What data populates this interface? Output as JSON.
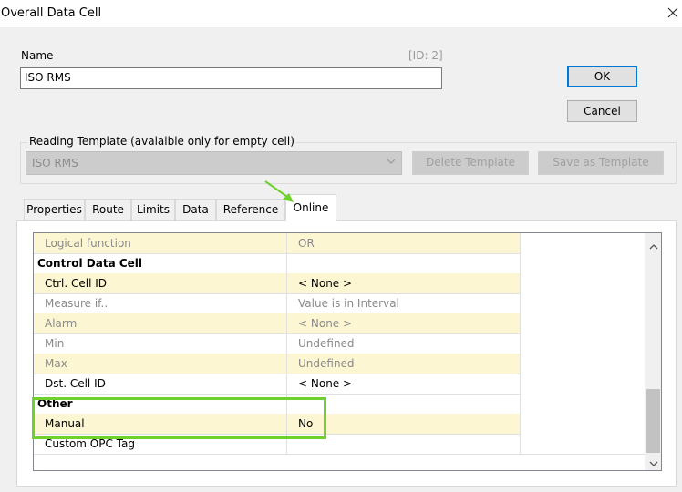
{
  "window": {
    "title": "Overall Data Cell"
  },
  "name_section": {
    "label": "Name",
    "id_label": "[ID: 2]",
    "value": "ISO RMS"
  },
  "buttons": {
    "ok": "OK",
    "cancel": "Cancel",
    "delete_template": "Delete Template",
    "save_template": "Save as Template"
  },
  "template_group": {
    "label": "Reading Template (avalaible only for empty cell)",
    "selected": "ISO RMS"
  },
  "tabs": [
    {
      "label": "Properties"
    },
    {
      "label": "Route"
    },
    {
      "label": "Limits"
    },
    {
      "label": "Data"
    },
    {
      "label": "Reference"
    },
    {
      "label": "Online",
      "active": true
    }
  ],
  "grid": {
    "rows": [
      {
        "c1": "Logical function",
        "c2": "OR"
      },
      {
        "c1": "Control Data Cell"
      },
      {
        "c1": "Ctrl. Cell ID",
        "c2": "< None >"
      },
      {
        "c1": "Measure if..",
        "c2": "Value is in Interval"
      },
      {
        "c1": "Alarm",
        "c2": "< None >"
      },
      {
        "c1": "Min",
        "c2": "Undefined"
      },
      {
        "c1": "Max",
        "c2": "Undefined"
      },
      {
        "c1": "Dst. Cell ID",
        "c2": "< None >"
      },
      {
        "c1": "Other"
      },
      {
        "c1": "Manual",
        "c2": "No"
      },
      {
        "c1": "Custom OPC Tag",
        "c2": ""
      }
    ]
  },
  "colors": {
    "highlight": "#fdf6d2",
    "annotation_green": "#6fd12b",
    "focus_blue": "#0078d7"
  },
  "icons": {
    "close": "close-icon",
    "annotation_arrow": "green-arrow-icon",
    "dropdown": "chevron-down-icon",
    "scroll_up": "chevron-up-icon",
    "scroll_down": "chevron-down-icon"
  }
}
